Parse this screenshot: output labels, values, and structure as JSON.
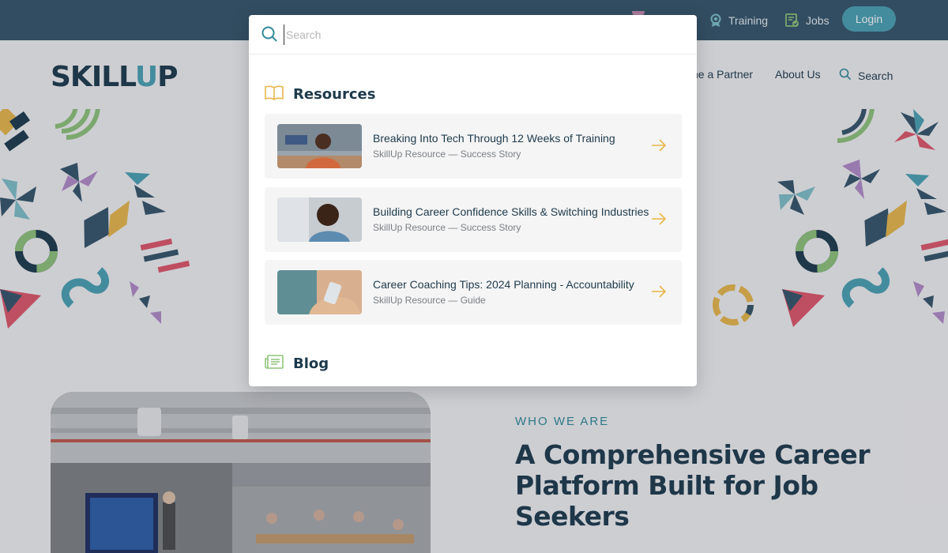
{
  "topbar": {
    "training_label": "Training",
    "jobs_label": "Jobs",
    "login_label": "Login"
  },
  "header": {
    "logo_main": "SKILL",
    "logo_u": "U",
    "logo_end": "P",
    "nav_partner": "ne a Partner",
    "nav_about": "About Us",
    "nav_search": "Search"
  },
  "search": {
    "placeholder": "Search"
  },
  "results": {
    "resources_title": "Resources",
    "blog_title": "Blog",
    "items": [
      {
        "title": "Breaking Into Tech Through 12 Weeks of Training",
        "subtitle": "SkillUp Resource — Success Story"
      },
      {
        "title": "Building Career Confidence Skills & Switching Industries",
        "subtitle": "SkillUp Resource — Success Story"
      },
      {
        "title": "Career Coaching Tips: 2024 Planning - Accountability",
        "subtitle": "SkillUp Resource — Guide"
      }
    ]
  },
  "about": {
    "eyebrow": "WHO WE ARE",
    "headline": "A Comprehensive Career Platform Built for Job Seekers"
  },
  "colors": {
    "topbar": "#35556a",
    "brand_navy": "#1d3a4c",
    "brand_teal": "#4aa2b4",
    "arrow_gold": "#e8b74a"
  }
}
